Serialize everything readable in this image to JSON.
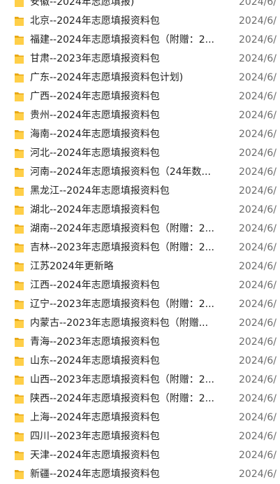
{
  "folder_icon": "folder-icon",
  "colors": {
    "folder_front": "#ffcf48",
    "folder_back": "#e8a814",
    "name_text": "#1f1f1f",
    "date_text": "#6d6d6d"
  },
  "rows": [
    {
      "name": "安徽--2024年志愿填报)",
      "date": "2024/6/"
    },
    {
      "name": "北京--2024年志愿填报资料包",
      "date": "2024/6/"
    },
    {
      "name": "福建--2024年志愿填报资料包（附赠：2...",
      "date": "2024/6/"
    },
    {
      "name": "甘肃--2023年志愿填报资料包",
      "date": "2024/6/"
    },
    {
      "name": "广东--2024年志愿填报资料包计划)",
      "date": "2024/6/"
    },
    {
      "name": "广西--2024年志愿填报资料包",
      "date": "2024/6/"
    },
    {
      "name": "贵州--2024年志愿填报资料包",
      "date": "2024/6/"
    },
    {
      "name": "海南--2024年志愿填报资料包",
      "date": "2024/6/"
    },
    {
      "name": "河北--2024年志愿填报资料包",
      "date": "2024/6/"
    },
    {
      "name": "河南--2024年志愿填报资料包（24年数...",
      "date": "2024/6/"
    },
    {
      "name": "黑龙江--2024年志愿填报资料包",
      "date": "2024/6/"
    },
    {
      "name": "湖北--2024年志愿填报资料包",
      "date": "2024/6/"
    },
    {
      "name": "湖南--2024年志愿填报资料包（附赠：2...",
      "date": "2024/6/"
    },
    {
      "name": "吉林--2023年志愿填报资料包（附赠：2...",
      "date": "2024/6/"
    },
    {
      "name": "江苏2024年更新略",
      "date": "2024/6/"
    },
    {
      "name": "江西--2024年志愿填报资料包",
      "date": "2024/6/"
    },
    {
      "name": "辽宁--2023年志愿填报资料包（附赠：2...",
      "date": "2024/6/"
    },
    {
      "name": "内蒙古--2023年志愿填报资料包（附赠...",
      "date": "2024/6/"
    },
    {
      "name": "青海--2023年志愿填报资料包",
      "date": "2024/6/"
    },
    {
      "name": "山东--2024年志愿填报资料包",
      "date": "2024/6/"
    },
    {
      "name": "山西--2023年志愿填报资料包（附赠：2...",
      "date": "2024/6/"
    },
    {
      "name": "陕西--2024年志愿填报资料包（附赠：2...",
      "date": "2024/6/"
    },
    {
      "name": "上海--2024年志愿填报资料包",
      "date": "2024/6/"
    },
    {
      "name": "四川--2023年志愿填报资料包",
      "date": "2024/6/"
    },
    {
      "name": "天津--2024年志愿填报资料包",
      "date": "2024/6/"
    },
    {
      "name": "新疆--2024年志愿填报资料包",
      "date": "2024/6/"
    }
  ]
}
